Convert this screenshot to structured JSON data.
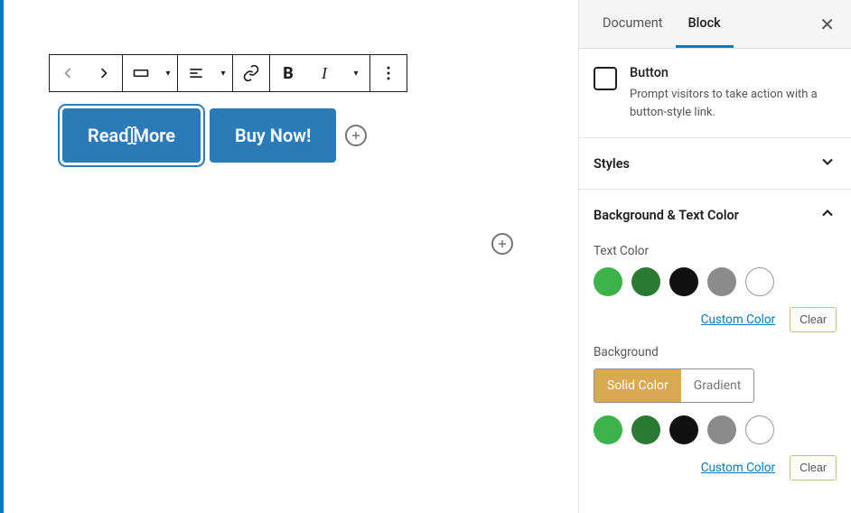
{
  "sidebar": {
    "tabs": {
      "document": "Document",
      "block": "Block"
    },
    "block_info": {
      "title": "Button",
      "description": "Prompt visitors to take action with a button-style link."
    },
    "panels": {
      "styles": {
        "title": "Styles"
      },
      "bg_text": {
        "title": "Background & Text Color",
        "text_color_label": "Text Color",
        "background_label": "Background",
        "solid_label": "Solid Color",
        "gradient_label": "Gradient",
        "custom_color": "Custom Color",
        "clear": "Clear"
      }
    },
    "swatches": {
      "green_light": "#3db24a",
      "green_dark": "#2a7a33",
      "black": "#111111",
      "gray": "#8b8b8b",
      "white": "#ffffff"
    }
  },
  "editor": {
    "buttons": {
      "read_more": "Read More",
      "buy_now": "Buy Now!"
    }
  }
}
